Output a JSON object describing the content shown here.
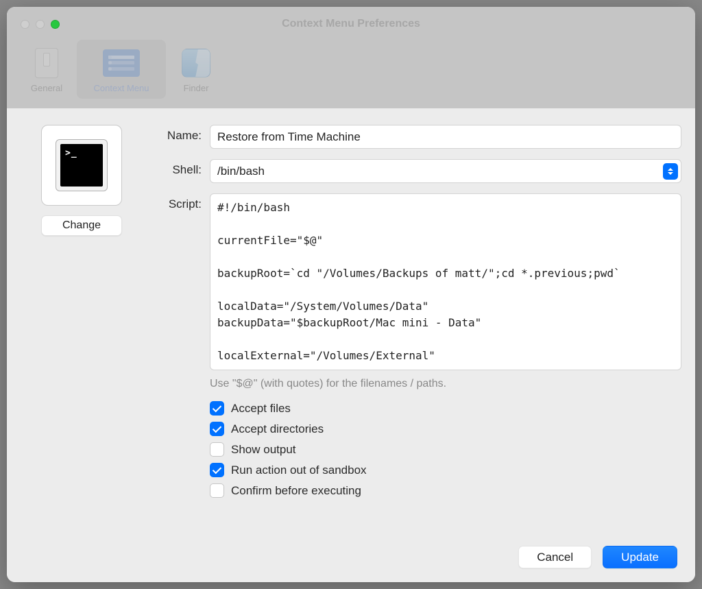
{
  "window": {
    "title": "Context Menu Preferences"
  },
  "toolbar": {
    "tabs": [
      {
        "label": "General"
      },
      {
        "label": "Context Menu"
      },
      {
        "label": "Finder"
      }
    ]
  },
  "sheet": {
    "change_label": "Change",
    "labels": {
      "name": "Name:",
      "shell": "Shell:",
      "script": "Script:"
    },
    "name_value": "Restore from Time Machine",
    "shell_value": "/bin/bash",
    "script_value": "#!/bin/bash\n\ncurrentFile=\"$@\"\n\nbackupRoot=`cd \"/Volumes/Backups of matt/\";cd *.previous;pwd`\n\nlocalData=\"/System/Volumes/Data\"\nbackupData=\"$backupRoot/Mac mini - Data\"\n\nlocalExternal=\"/Volumes/External\"",
    "hint": "Use \"$@\" (with quotes) for the filenames / paths.",
    "checkboxes": [
      {
        "label": "Accept files",
        "checked": true
      },
      {
        "label": "Accept directories",
        "checked": true
      },
      {
        "label": "Show output",
        "checked": false
      },
      {
        "label": "Run action out of sandbox",
        "checked": true
      },
      {
        "label": "Confirm before executing",
        "checked": false
      }
    ],
    "buttons": {
      "cancel": "Cancel",
      "update": "Update"
    }
  }
}
